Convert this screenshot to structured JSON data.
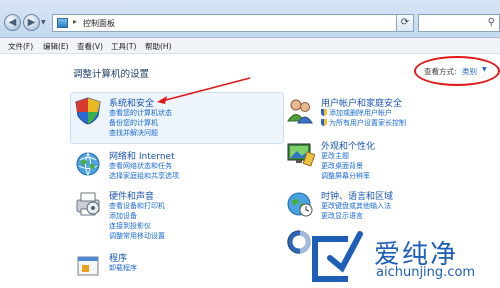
{
  "address": {
    "path_separator": "▸",
    "current": "控制面板"
  },
  "menu": {
    "items": [
      "文件(F)",
      "编辑(E)",
      "查看(V)",
      "工具(T)",
      "帮助(H)"
    ]
  },
  "page": {
    "title": "调整计算机的设置",
    "view_by_label": "查看方式:",
    "view_by_value": "类别"
  },
  "categories": {
    "system": {
      "title": "系统和安全",
      "links": [
        "查看您的计算机状态",
        "备份您的计算机",
        "查找并解决问题"
      ]
    },
    "network": {
      "title": "网络和 Internet",
      "links": [
        "查看网络状态和任务",
        "选择家庭组和共享选项"
      ]
    },
    "hardware": {
      "title": "硬件和声音",
      "links": [
        "查看设备和打印机",
        "添加设备",
        "连接到投影仪",
        "调整常用移动设置"
      ]
    },
    "programs": {
      "title": "程序",
      "links": [
        "卸载程序"
      ]
    },
    "users": {
      "title": "用户帐户和家庭安全",
      "links": [
        "添加或删除用户帐户",
        "为所有用户设置家长控制"
      ]
    },
    "appearance": {
      "title": "外观和个性化",
      "links": [
        "更改主题",
        "更改桌面背景",
        "调整屏幕分辨率"
      ]
    },
    "clock": {
      "title": "时钟、语言和区域",
      "links": [
        "更改键盘或其他输入法",
        "更改显示语言"
      ]
    }
  },
  "watermark": {
    "title": "爱纯净",
    "url": "aichunjing.com"
  },
  "colors": {
    "link": "#1a6ad2",
    "heading": "#1a55b0",
    "annotation": "#e01818"
  }
}
